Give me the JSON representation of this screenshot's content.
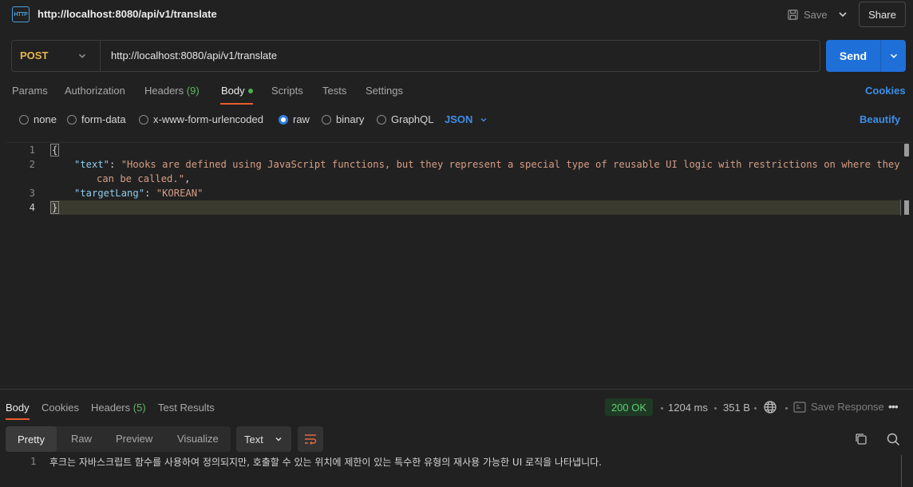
{
  "header": {
    "icon_text": "HTTP",
    "title": "http://localhost:8080/api/v1/translate",
    "save_label": "Save",
    "share_label": "Share"
  },
  "request": {
    "method": "POST",
    "url": "http://localhost:8080/api/v1/translate",
    "send_label": "Send"
  },
  "request_tabs": {
    "params": "Params",
    "authorization": "Authorization",
    "headers": "Headers",
    "headers_count": "(9)",
    "body": "Body",
    "scripts": "Scripts",
    "tests": "Tests",
    "settings": "Settings",
    "cookies": "Cookies"
  },
  "body_types": {
    "none": "none",
    "form_data": "form-data",
    "urlencoded": "x-www-form-urlencoded",
    "raw": "raw",
    "binary": "binary",
    "graphql": "GraphQL",
    "format": "JSON",
    "beautify": "Beautify"
  },
  "editor": {
    "line_numbers": [
      "1",
      "2",
      "3",
      "4"
    ],
    "key_text": "\"text\"",
    "value_text_1": "\"Hooks are defined using JavaScript functions, but they represent a special type of reusable UI logic with restrictions on where they",
    "value_text_2": "can be called.\"",
    "key_lang": "\"targetLang\"",
    "value_lang": "\"KOREAN\""
  },
  "response_tabs": {
    "body": "Body",
    "cookies": "Cookies",
    "headers": "Headers",
    "headers_count": "(5)",
    "test_results": "Test Results"
  },
  "response_meta": {
    "status": "200 OK",
    "time": "1204 ms",
    "size": "351 B",
    "save_response": "Save Response"
  },
  "response_view": {
    "pretty": "Pretty",
    "raw": "Raw",
    "preview": "Preview",
    "visualize": "Visualize",
    "format": "Text"
  },
  "response_body": {
    "line": "1",
    "text": "후크는 자바스크립트 함수를 사용하여 정의되지만, 호출할 수 있는 위치에 제한이 있는 특수한 유형의 재사용 가능한 UI 로직을 나타냅니다."
  },
  "colors": {
    "accent_blue": "#1f6fd9",
    "method_post": "#e6b84d",
    "tab_underline": "#e85d2b",
    "status_ok": "#5fcf72"
  }
}
